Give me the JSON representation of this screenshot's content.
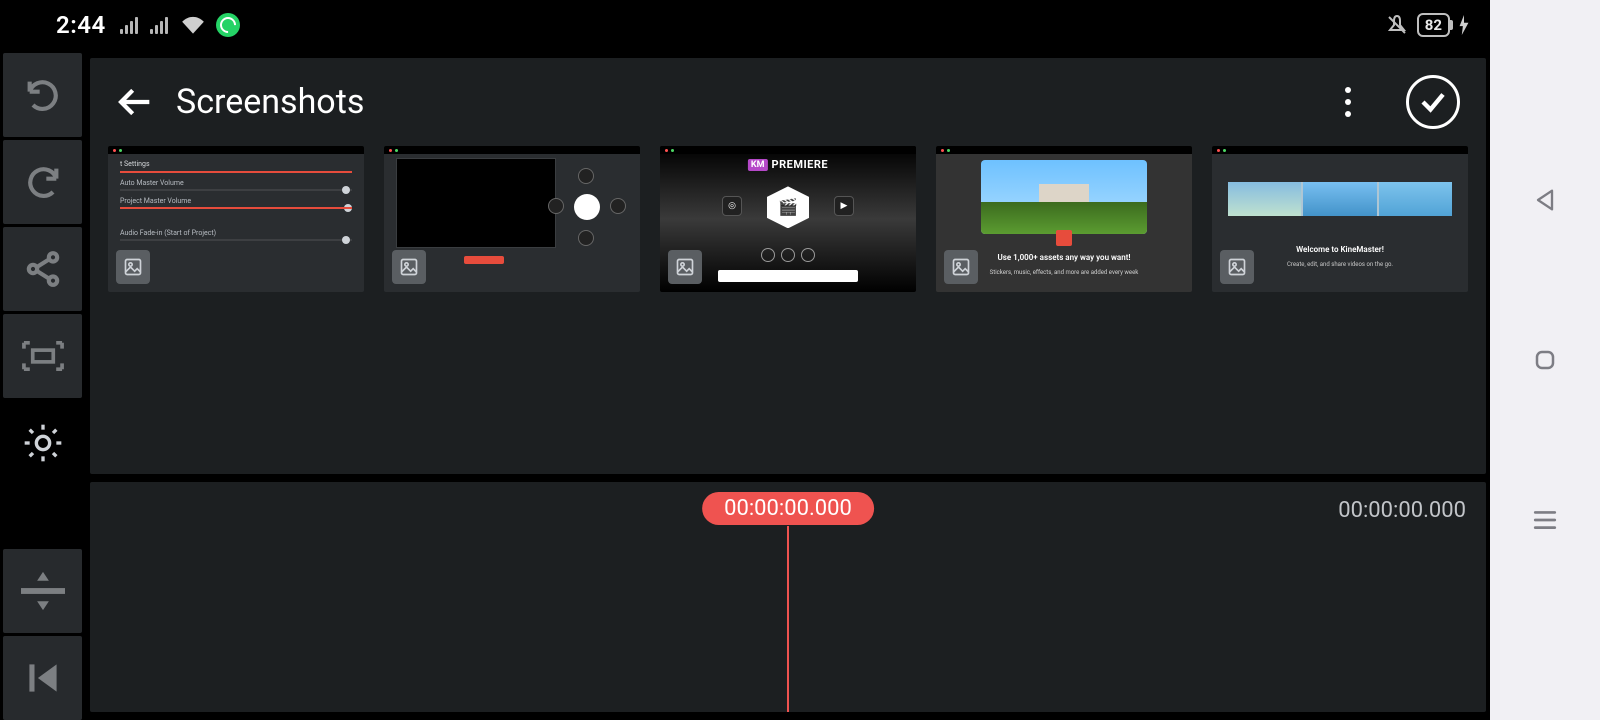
{
  "status": {
    "time": "2:44",
    "battery": "82"
  },
  "browser": {
    "title": "Screenshots"
  },
  "thumbs": {
    "t1": {
      "a": "Auto Master Volume",
      "b": "Project Master Volume",
      "c": "Audio Fade-in (Start of Project)"
    },
    "t3": {
      "km": "KM",
      "prem": "PREMIERE"
    },
    "t4": {
      "line1": "Use 1,000+ assets any way you want!",
      "line2": "Stickers, music, effects, and more are added every week"
    },
    "t5": {
      "line1": "Welcome to KineMaster!",
      "line2": "Create, edit, and share videos on the go."
    }
  },
  "timeline": {
    "playhead": "00:00:00.000",
    "duration": "00:00:00.000"
  }
}
